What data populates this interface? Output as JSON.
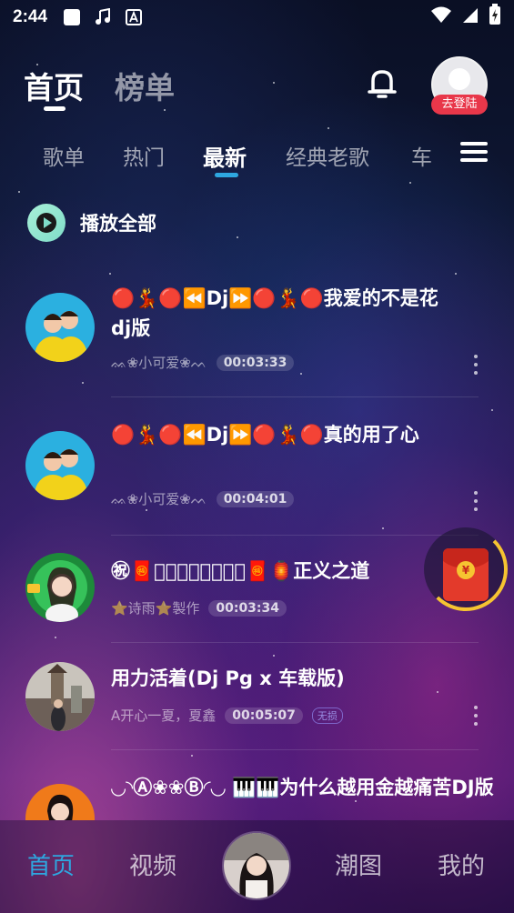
{
  "status_bar": {
    "time": "2:44"
  },
  "header": {
    "tabs": [
      {
        "label": "首页",
        "active": true
      },
      {
        "label": "榜单",
        "active": false
      }
    ],
    "login_badge": "去登陆"
  },
  "categories": [
    {
      "label": "歌单",
      "active": false
    },
    {
      "label": "热门",
      "active": false
    },
    {
      "label": "最新",
      "active": true
    },
    {
      "label": "经典老歌",
      "active": false
    },
    {
      "label": "车",
      "active": false
    }
  ],
  "play_all": {
    "label": "播放全部"
  },
  "songs": [
    {
      "title": "🔴💃🔴⏪Dj⏩🔴💃🔴我爱的不是花dj版",
      "artist": "ᨐ❀小可爱❀ᨓ",
      "duration": "00:03:33",
      "badge": ""
    },
    {
      "title": "🔴💃🔴⏪Dj⏩🔴💃🔴真的用了心",
      "artist": "ᨐ❀小可爱❀ᨓ",
      "duration": "00:04:01",
      "badge": ""
    },
    {
      "title": "㊗🧧马ᷓ年ᷓ大ᷓ吉ᷓ🧧🏮正义之道",
      "artist": "⭐诗雨⭐製作",
      "duration": "00:03:34",
      "badge": ""
    },
    {
      "title": "用力活着(Dj Pg x 车载版)",
      "artist": "A开心一夏，夏鑫",
      "duration": "00:05:07",
      "badge": "无损"
    },
    {
      "title": "◡◝Ⓐ❀❀Ⓑ◜◡ 🎹🎹为什么越用金越痛苦DJ版",
      "artist": "",
      "duration": "",
      "badge": ""
    }
  ],
  "bottom_nav": [
    {
      "label": "首页",
      "active": true
    },
    {
      "label": "视频",
      "active": false
    },
    {
      "label": "潮图",
      "active": false
    },
    {
      "label": "我的",
      "active": false
    }
  ],
  "colors": {
    "accent": "#2ea7e0",
    "login_badge": "#e8374a",
    "redpacket": "#e33a2b",
    "ring": "#f6c431"
  }
}
